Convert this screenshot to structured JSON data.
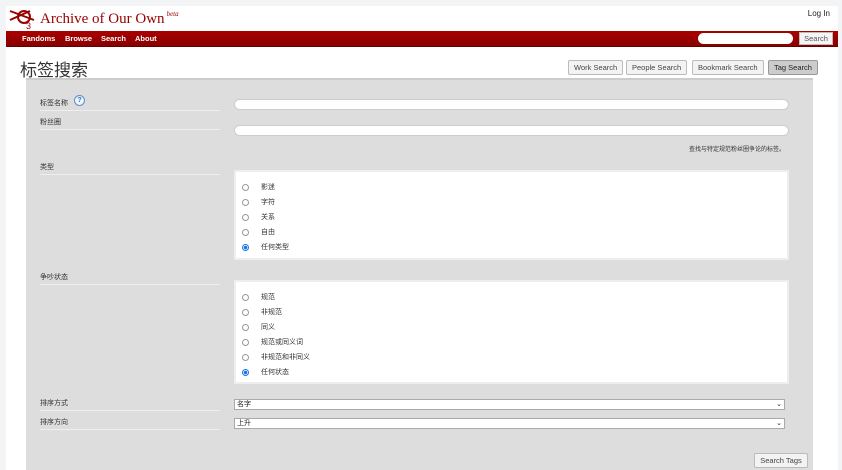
{
  "header": {
    "site_name": "Archive of Our Own",
    "beta": "beta",
    "login": "Log In"
  },
  "nav": {
    "items": [
      "Fandoms",
      "Browse",
      "Search",
      "About"
    ],
    "search_placeholder": "",
    "search_button": "Search"
  },
  "page": {
    "title": "标签搜索"
  },
  "tabs": [
    {
      "label": "Work Search",
      "active": false
    },
    {
      "label": "People Search",
      "active": false
    },
    {
      "label": "Bookmark Search",
      "active": false
    },
    {
      "label": "Tag Search",
      "active": true
    }
  ],
  "form": {
    "tag_name_label": "标签名称",
    "help": "?",
    "tag_name_value": "",
    "fandom_label": "粉丝圈",
    "fandom_value": "",
    "fandom_hint": "查找与特定规范粉丝圈争论的标签。",
    "type_label": "类型",
    "type_options": [
      "影迷",
      "字符",
      "关系",
      "自由",
      "任何类型"
    ],
    "type_selected": 4,
    "status_label": "争吵状态",
    "status_options": [
      "规范",
      "非规范",
      "同义",
      "规范或同义词",
      "非规范和非同义",
      "任何状态"
    ],
    "status_selected": 5,
    "sort_by_label": "排序方式",
    "sort_by_value": "名字",
    "sort_dir_label": "排序方向",
    "sort_dir_value": "上升",
    "submit": "Search Tags"
  }
}
